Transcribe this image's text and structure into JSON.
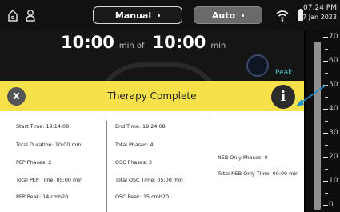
{
  "status_bar": {
    "mode_manual": "Manual",
    "mode_auto": "Auto",
    "time": "07:24 PM",
    "date": "27 Jan 2023"
  },
  "timer": {
    "elapsed": "10:00",
    "of_label": "min of",
    "total": "10:00",
    "unit": "min"
  },
  "gauge": {
    "peak_label": "Peak"
  },
  "scale": {
    "labels": [
      "70",
      "60",
      "50",
      "40",
      "30",
      "20",
      "10",
      "0"
    ]
  },
  "dialog": {
    "close_label": "X",
    "title": "Therapy Complete",
    "info_label": "i",
    "col1": [
      "Start Time:  19:14:08",
      "Total Duration: 10:00 min",
      "PEP Phases: 2",
      "Total PEP Time: 05:00 min",
      "PEP Peak: 14 cmh20"
    ],
    "col2": [
      "End Time:  19:24:08",
      "Total Phases: 4",
      "OSC Phases: 2",
      "Total OSC Time: 05:00 min",
      "OSC Peak: 15 cmh20"
    ],
    "col3": [
      "NEB Only Phases: 0",
      "Total NEB Only Time: 00:00 min"
    ]
  },
  "colors": {
    "header": "#f6e14b",
    "arrow": "#1a8fd6",
    "peak_text": "#4fc4c8"
  }
}
